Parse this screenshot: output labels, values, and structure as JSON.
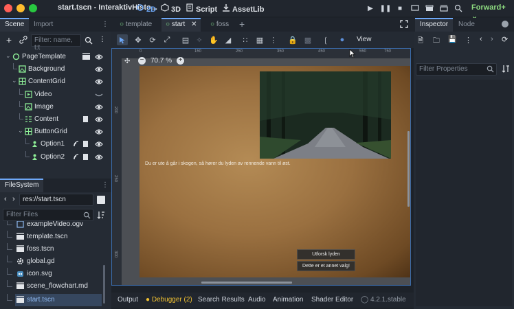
{
  "window": {
    "title": "start.tscn - InteraktivHisto...",
    "renderer": "Forward+",
    "workspaces": [
      {
        "label": "2D",
        "icon": "2d-icon",
        "active": true
      },
      {
        "label": "3D",
        "icon": "3d-icon",
        "active": false
      },
      {
        "label": "Script",
        "icon": "script-icon",
        "active": false
      },
      {
        "label": "AssetLib",
        "icon": "assetlib-icon",
        "active": false
      }
    ],
    "traffic_lights": [
      "#ff5f57",
      "#febc2e",
      "#28c840"
    ]
  },
  "scene_dock": {
    "tabs": [
      "Scene",
      "Import"
    ],
    "filter_placeholder": "Filter: name, t:t",
    "nodes": [
      {
        "name": "PageTemplate",
        "depth": 0,
        "icon": "control-node-icon",
        "color": "#8eef97"
      },
      {
        "name": "Background",
        "depth": 1,
        "icon": "texture-rect-icon",
        "color": "#8eef97"
      },
      {
        "name": "ContentGrid",
        "depth": 1,
        "icon": "grid-container-icon",
        "color": "#8eef97"
      },
      {
        "name": "Video",
        "depth": 2,
        "icon": "video-player-icon",
        "color": "#8eef97"
      },
      {
        "name": "Image",
        "depth": 2,
        "icon": "texture-rect-icon",
        "color": "#8eef97"
      },
      {
        "name": "Content",
        "depth": 2,
        "icon": "rich-text-icon",
        "color": "#8eef97"
      },
      {
        "name": "ButtonGrid",
        "depth": 2,
        "icon": "grid-container-icon",
        "color": "#8eef97"
      },
      {
        "name": "Option1",
        "depth": 3,
        "icon": "button-icon",
        "color": "#8eef97"
      },
      {
        "name": "Option2",
        "depth": 3,
        "icon": "button-icon",
        "color": "#8eef97"
      }
    ]
  },
  "filesystem": {
    "tab": "FileSystem",
    "path": "res://start.tscn",
    "filter_placeholder": "Filter Files",
    "files": [
      {
        "name": "exampleVideo.ogv",
        "icon": "video-file-icon",
        "partial": true
      },
      {
        "name": "template.tscn",
        "icon": "scene-file-icon"
      },
      {
        "name": "foss.tscn",
        "icon": "scene-file-icon"
      },
      {
        "name": "global.gd",
        "icon": "gear-icon"
      },
      {
        "name": "icon.svg",
        "icon": "godot-icon"
      },
      {
        "name": "scene_flowchart.md",
        "icon": "scene-file-icon"
      },
      {
        "name": "start.tscn",
        "icon": "scene-file-icon",
        "selected": true
      }
    ]
  },
  "editor": {
    "scene_tabs": [
      {
        "label": "template",
        "active": false
      },
      {
        "label": "start",
        "active": true
      },
      {
        "label": "foss",
        "active": false
      }
    ],
    "zoom": "70.7 %",
    "view_menu": "View",
    "ruler_ticks_h": [
      "0",
      "150",
      "250",
      "350",
      "450",
      "550",
      "650",
      "750"
    ],
    "ruler_ticks_v": [
      "200",
      "250",
      "300"
    ],
    "story_text": "Du er ute å går i skogen, så hører du lyden av rennende vann til øst.",
    "buttons": [
      "Utforsk lyden",
      "Dette er et annet valg!"
    ]
  },
  "bottom_panel": {
    "tabs": [
      "Output",
      "Debugger (2)",
      "Search Results",
      "Audio",
      "Animation",
      "Shader Editor"
    ],
    "version": "4.2.1.stable"
  },
  "inspector": {
    "tabs": [
      "Inspector",
      "Node"
    ],
    "filter_placeholder": "Filter Properties"
  }
}
